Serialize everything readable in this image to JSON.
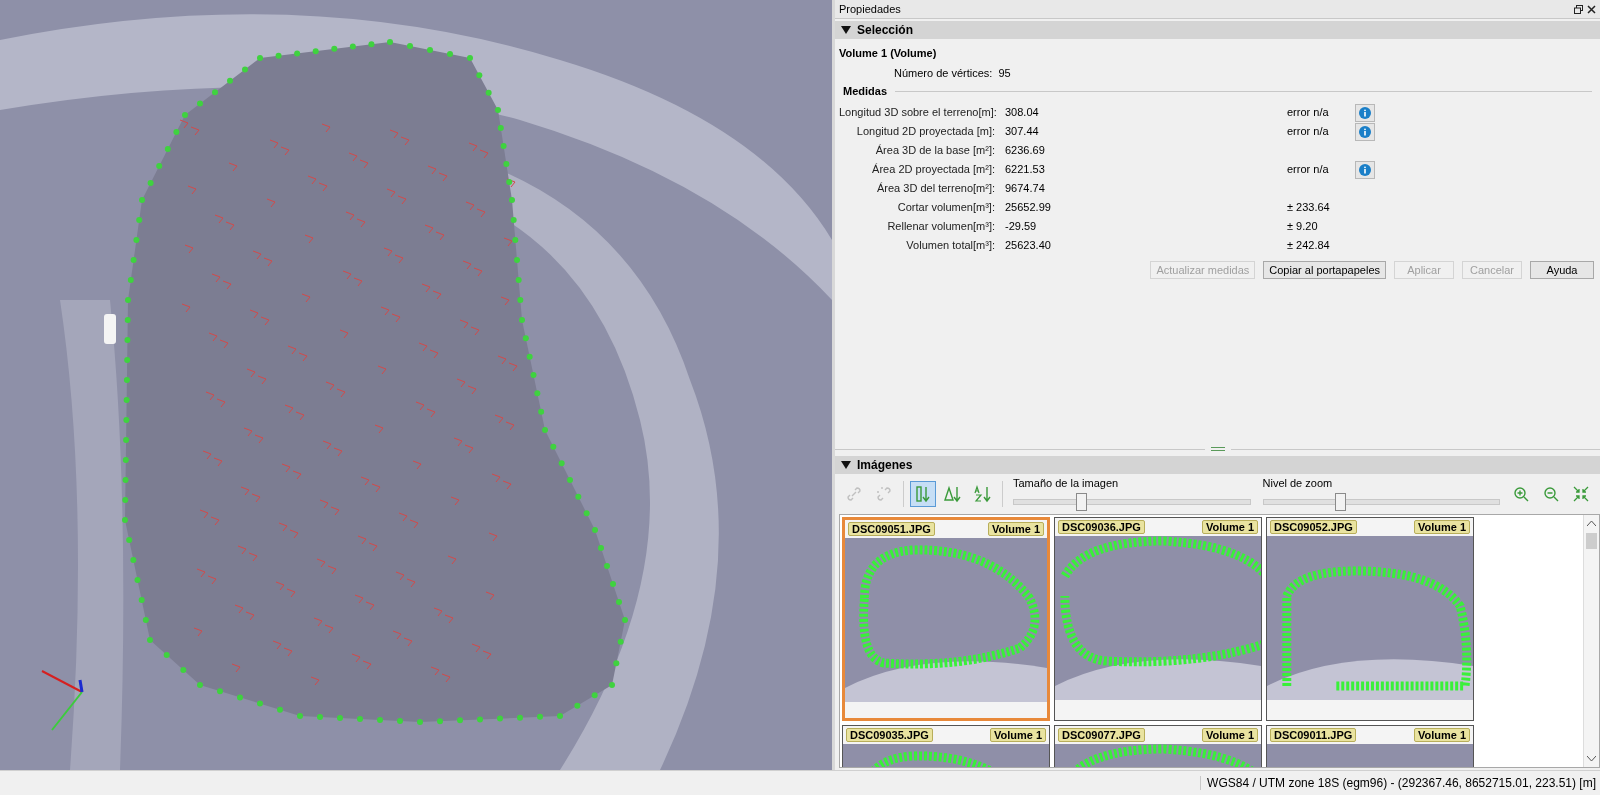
{
  "window": {
    "title": "Propiedades"
  },
  "selection": {
    "title": "Selección",
    "expanded": true,
    "object": "Volume 1 (Volume)",
    "vertices_label": "Número de vértices:",
    "vertices_value": "95"
  },
  "measures": {
    "title": "Medidas",
    "rows": [
      {
        "label": "Longitud 3D sobre el terreno[m]:",
        "value": "308.04",
        "extra": "error n/a",
        "info": true
      },
      {
        "label": "Longitud 2D proyectada [m]:",
        "value": "307.44",
        "extra": "error n/a",
        "info": true
      },
      {
        "label": "Área 3D de la base [m²]:",
        "value": "6236.69",
        "info": false
      },
      {
        "label": "Área 2D proyectada [m²]:",
        "value": "6221.53",
        "extra": "error n/a",
        "info": true
      },
      {
        "label": "Área 3D del terreno[m²]:",
        "value": "9674.74",
        "info": false
      },
      {
        "label": "Cortar volumen[m³]:",
        "value": "25652.99",
        "extra": "± 233.64",
        "info": false
      },
      {
        "label": "Rellenar volumen[m³]:",
        "value": "-29.59",
        "extra": "± 9.20",
        "info": false
      },
      {
        "label": "Volumen total[m³]:",
        "value": "25623.40",
        "extra": "± 242.84",
        "info": false
      }
    ]
  },
  "buttons": [
    {
      "label": "Actualizar medidas",
      "disabled": true
    },
    {
      "label": "Copiar al portapapeles",
      "disabled": false
    },
    {
      "label": "Aplicar",
      "disabled": true
    },
    {
      "label": "Cancelar",
      "disabled": true
    },
    {
      "label": "Ayuda",
      "disabled": false
    }
  ],
  "images": {
    "title": "Imágenes",
    "expanded": true,
    "tools": [
      {
        "kind": "link",
        "disabled": true,
        "selected": false
      },
      {
        "kind": "unlink",
        "disabled": true,
        "selected": false
      },
      {
        "kind": "sort-order",
        "disabled": false,
        "selected": true
      },
      {
        "kind": "sort-delta",
        "disabled": false,
        "selected": false
      },
      {
        "kind": "sort-az",
        "disabled": false,
        "selected": false
      }
    ],
    "sliders": [
      {
        "label": "Tamaño de la imagen",
        "level": 0.28
      },
      {
        "label": "Nivel de zoom",
        "level": 0.32
      }
    ],
    "zoom_tools": [
      {
        "kind": "zoom-in"
      },
      {
        "kind": "zoom-out"
      },
      {
        "kind": "fit"
      }
    ],
    "thumbnails": [
      {
        "name": "DSC09051.JPG",
        "tag": "Volume 1",
        "selected": true
      },
      {
        "name": "DSC09036.JPG",
        "tag": "Volume 1",
        "selected": false
      },
      {
        "name": "DSC09052.JPG",
        "tag": "Volume 1",
        "selected": false
      },
      {
        "name": "DSC09035.JPG",
        "tag": "Volume 1",
        "selected": false
      },
      {
        "name": "DSC09077.JPG",
        "tag": "Volume 1",
        "selected": false
      },
      {
        "name": "DSC09011.JPG",
        "tag": "Volume 1",
        "selected": false
      }
    ]
  },
  "status_bar": "WGS84 / UTM zone 18S (egm96) - (292367.46, 8652715.01, 223.51) [m]"
}
